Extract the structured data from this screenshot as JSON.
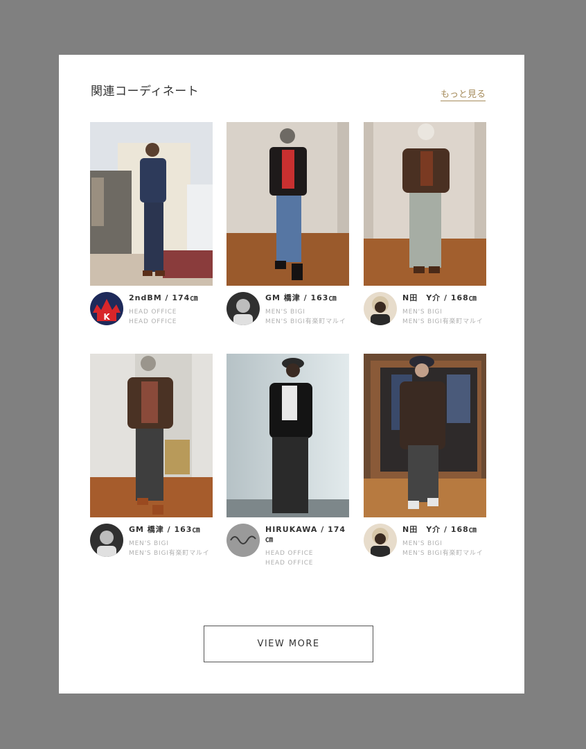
{
  "section": {
    "title": "関連コーディネート",
    "more_link": "もっと見る"
  },
  "items": [
    {
      "name": "2ndBM / 174㎝",
      "shop1": "HEAD OFFICE",
      "shop2": "HEAD OFFICE",
      "avatar_icon": "k-logo-avatar",
      "bg": "#dfe3e8",
      "floor": "#cdbfae"
    },
    {
      "name": "GM 橋津 / 163㎝",
      "shop1": "MEN'S BIGI",
      "shop2": "MEN'S BIGI有楽町マルイ",
      "avatar_icon": "person-avatar",
      "bg": "#d9d2c9",
      "floor": "#9a5a2c"
    },
    {
      "name": "N田　Y介 / 168㎝",
      "shop1": "MEN'S BIGI",
      "shop2": "MEN'S BIGI有楽町マルイ",
      "avatar_icon": "person-avatar",
      "bg": "#ddd5cc",
      "floor": "#a25f2e"
    },
    {
      "name": "GM 橋津 / 163㎝",
      "shop1": "MEN'S BIGI",
      "shop2": "MEN'S BIGI有楽町マルイ",
      "avatar_icon": "person-avatar",
      "bg": "#e3e1dd",
      "floor": "#a65c2c"
    },
    {
      "name": "HIRUKAWA / 174㎝",
      "shop1": "HEAD OFFICE",
      "shop2": "HEAD OFFICE",
      "avatar_icon": "signature-avatar",
      "bg": "#c9d3d6",
      "floor": "#7d878a"
    },
    {
      "name": "N田　Y介 / 168㎝",
      "shop1": "MEN'S BIGI",
      "shop2": "MEN'S BIGI有楽町マルイ",
      "avatar_icon": "person-avatar",
      "bg": "#6b4a32",
      "floor": "#b77a40"
    }
  ],
  "view_more_button": "VIEW MORE"
}
